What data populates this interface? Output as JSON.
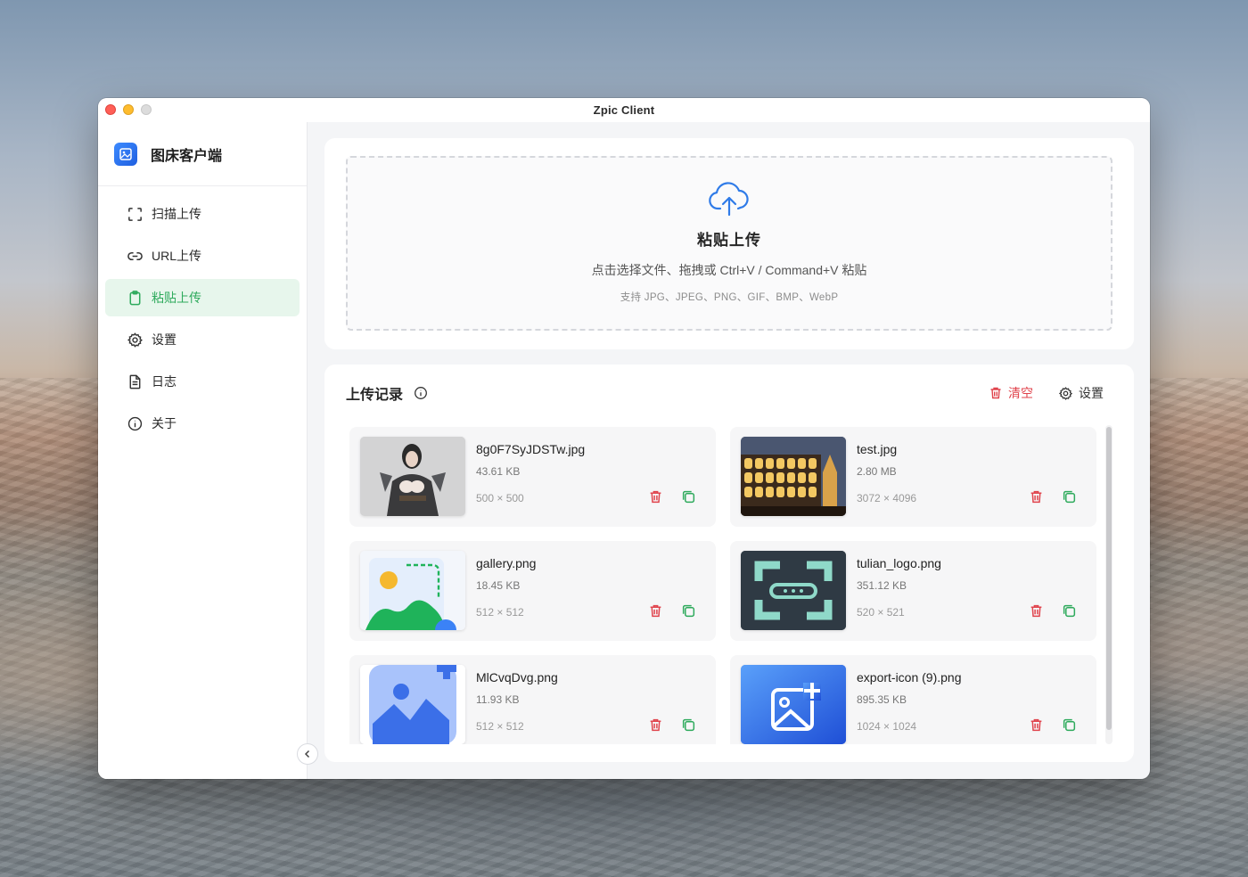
{
  "window": {
    "title": "Zpic Client"
  },
  "sidebar": {
    "brand_name": "图床客户端",
    "items": [
      {
        "label": "扫描上传",
        "icon": "scan-icon",
        "active": false
      },
      {
        "label": "URL上传",
        "icon": "link-icon",
        "active": false
      },
      {
        "label": "粘贴上传",
        "icon": "clipboard-icon",
        "active": true
      },
      {
        "label": "设置",
        "icon": "gear-icon",
        "active": false
      },
      {
        "label": "日志",
        "icon": "document-icon",
        "active": false
      },
      {
        "label": "关于",
        "icon": "info-icon",
        "active": false
      }
    ]
  },
  "upload": {
    "title": "粘贴上传",
    "subtitle": "点击选择文件、拖拽或 Ctrl+V / Command+V 粘贴",
    "hint": "支持 JPG、JPEG、PNG、GIF、BMP、WebP"
  },
  "history": {
    "title": "上传记录",
    "clear_label": "清空",
    "settings_label": "设置",
    "items": [
      {
        "name": "8g0F7SyJDSTw.jpg",
        "size": "43.61 KB",
        "dims": "500 × 500"
      },
      {
        "name": "test.jpg",
        "size": "2.80 MB",
        "dims": "3072 × 4096"
      },
      {
        "name": "gallery.png",
        "size": "18.45 KB",
        "dims": "512 × 512"
      },
      {
        "name": "tulian_logo.png",
        "size": "351.12 KB",
        "dims": "520 × 521"
      },
      {
        "name": "MlCvqDvg.png",
        "size": "11.93 KB",
        "dims": "512 × 512"
      },
      {
        "name": "export-icon (9).png",
        "size": "895.35 KB",
        "dims": "1024 × 1024"
      }
    ]
  },
  "colors": {
    "accent_green": "#2eaa5c",
    "active_bg": "#e7f6ec",
    "danger_red": "#e0434c",
    "upload_blue": "#2f7be8"
  }
}
